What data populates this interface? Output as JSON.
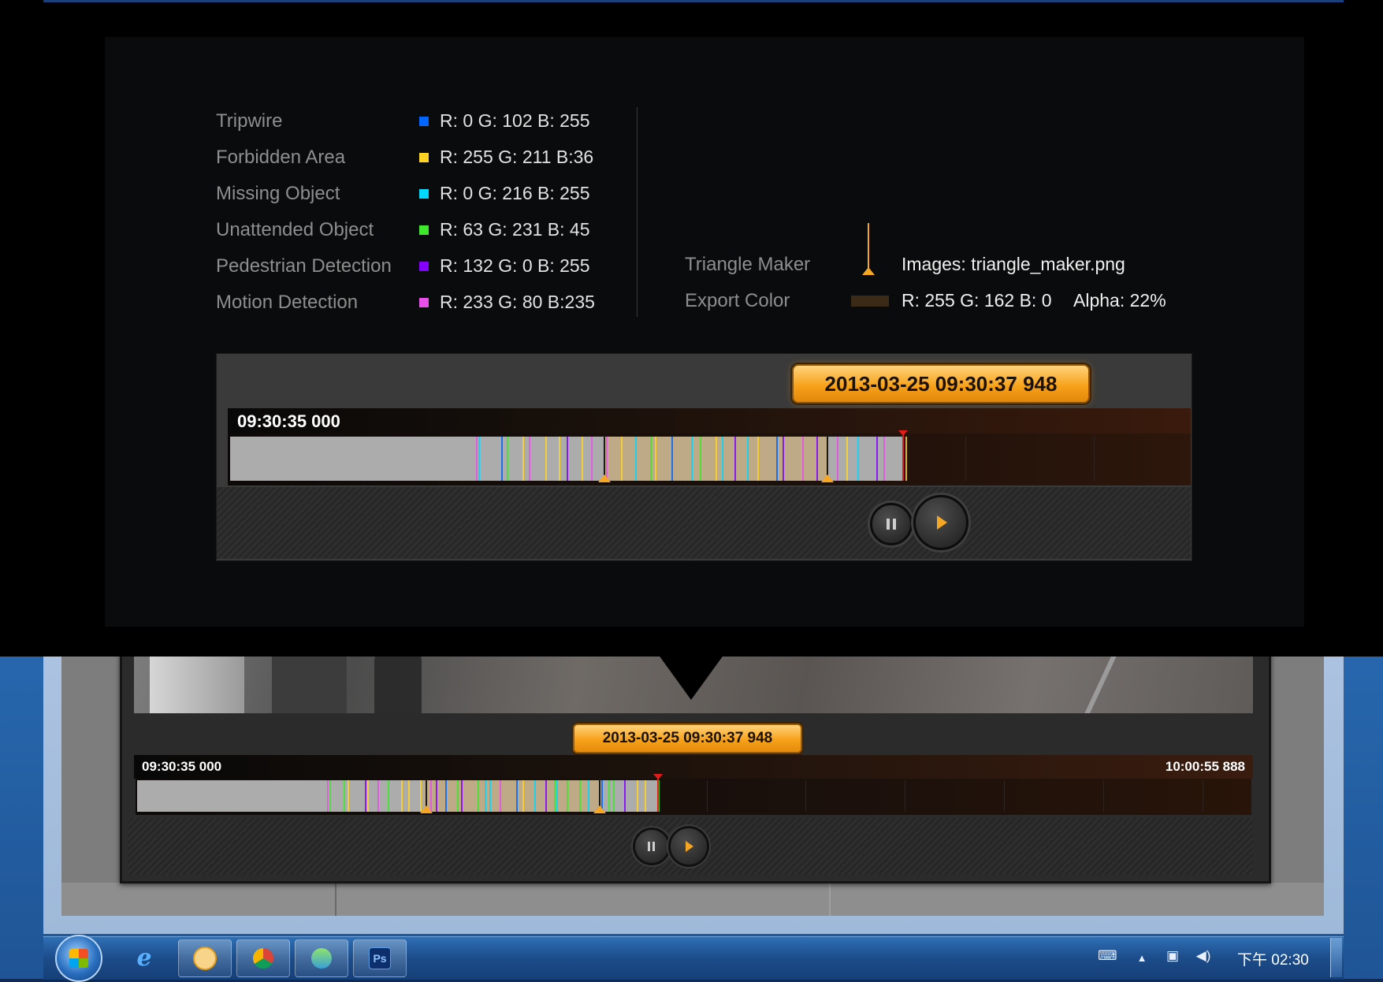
{
  "legend": [
    {
      "label": "Tripwire",
      "value": "R: 0 G: 102 B: 255",
      "color": "#0066ff"
    },
    {
      "label": "Forbidden Area",
      "value": "R: 255 G: 211 B:36",
      "color": "#ffd324"
    },
    {
      "label": "Missing Object",
      "value": "R: 0 G: 216 B: 255",
      "color": "#00d8ff"
    },
    {
      "label": "Unattended Object",
      "value": "R: 63 G: 231 B: 45",
      "color": "#3fe72d"
    },
    {
      "label": "Pedestrian Detection",
      "value": "R: 132 G: 0 B: 255",
      "color": "#8400ff"
    },
    {
      "label": "Motion Detection",
      "value": "R: 233 G: 80 B:235",
      "color": "#e950eb"
    }
  ],
  "triangle_maker": {
    "label": "Triangle Maker",
    "value": "Images: triangle_maker.png",
    "color": "#f5a623"
  },
  "export_color": {
    "label": "Export Color",
    "value": "R: 255 G: 162 B: 0",
    "alpha": "Alpha: 22%",
    "color": "#ffa200"
  },
  "big_player": {
    "timestamp": "2013-03-25 09:30:37 948",
    "start_time": "09:30:35 000"
  },
  "small_player": {
    "timestamp": "2013-03-25 09:30:37 948",
    "start_time": "09:30:35 000",
    "end_time": "10:00:55 888"
  },
  "taskbar": {
    "apps": [
      "internet-explorer",
      "clock-app",
      "chrome",
      "people-app",
      "photoshop"
    ],
    "photoshop_label": "Ps",
    "clock": "下午 02:30"
  }
}
